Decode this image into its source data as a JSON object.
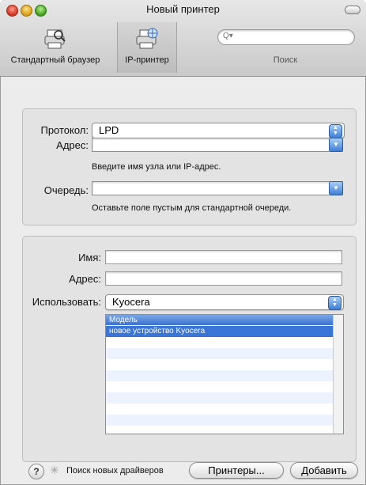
{
  "window": {
    "title": "Новый принтер"
  },
  "toolbar": {
    "items": [
      {
        "label": "Стандартный браузер",
        "icon": "printer-browser-icon"
      },
      {
        "label": "IP-принтер",
        "icon": "ip-printer-icon"
      }
    ],
    "search_label": "Поиск",
    "search_placeholder": "Q▾"
  },
  "connection": {
    "protocol_label": "Протокол:",
    "protocol_value": "LPD",
    "address_label": "Адрес:",
    "address_value": "",
    "address_hint": "Введите имя узла или IP-адрес.",
    "queue_label": "Очередь:",
    "queue_value": "",
    "queue_hint": "Оставьте поле пустым для стандартной очереди."
  },
  "printer": {
    "name_label": "Имя:",
    "name_value": "",
    "location_label": "Адрес:",
    "location_value": "",
    "use_label": "Использовать:",
    "use_value": "Kyocera",
    "model_header": "Модель",
    "models": [
      "новое устройство Kyocera"
    ]
  },
  "footer": {
    "help": "?",
    "search_drivers": "Поиск новых драйверов",
    "printers_button": "Принтеры...",
    "add_button": "Добавить"
  },
  "colors": {
    "accent": "#3875d7"
  }
}
